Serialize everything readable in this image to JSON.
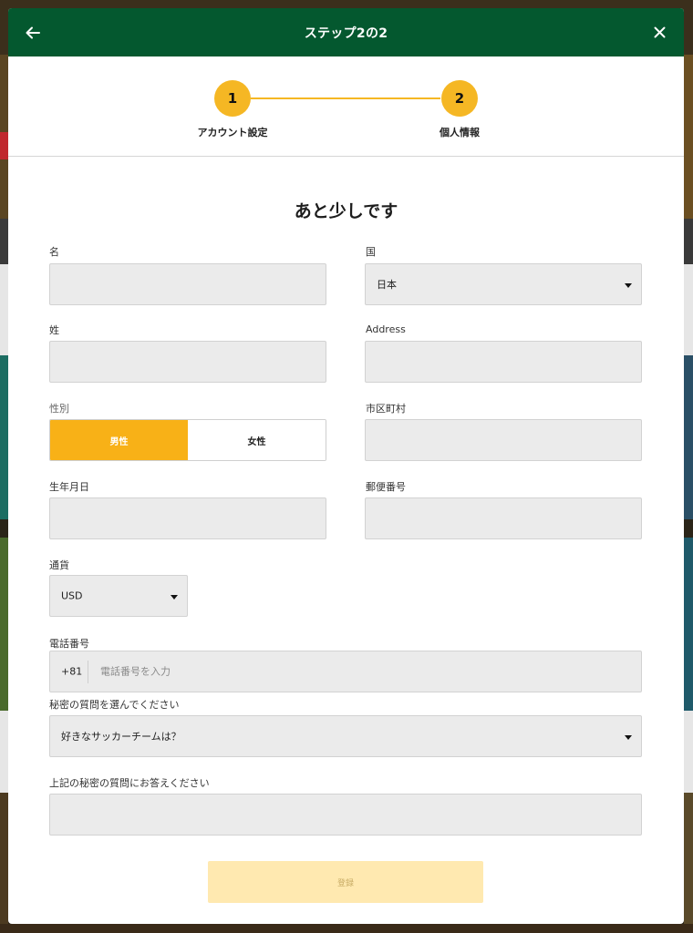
{
  "header": {
    "title": "ステップ2の2",
    "back_icon": "arrow-left-icon",
    "close_icon": "close-icon"
  },
  "stepper": {
    "steps": [
      {
        "number": "1",
        "label": "アカウント設定"
      },
      {
        "number": "2",
        "label": "個人情報"
      }
    ],
    "accent_color": "#f5b724"
  },
  "form": {
    "heading": "あと少しです",
    "first_name": {
      "label": "名",
      "value": ""
    },
    "last_name": {
      "label": "姓",
      "value": ""
    },
    "gender": {
      "label": "性別",
      "options": [
        "男性",
        "女性"
      ],
      "selected": "男性"
    },
    "birthdate": {
      "label": "生年月日",
      "value": ""
    },
    "currency": {
      "label": "通貨",
      "value": "USD"
    },
    "phone": {
      "label": "電話番号",
      "prefix": "+81",
      "placeholder": "電話番号を入力",
      "value": ""
    },
    "security_question": {
      "label": "秘密の質問を選んでください",
      "value": "好きなサッカーチームは？"
    },
    "security_answer": {
      "label": "上記の秘密の質問にお答えください",
      "value": ""
    },
    "country": {
      "label": "国",
      "value": "日本"
    },
    "address": {
      "label": "Address",
      "value": ""
    },
    "city": {
      "label": "市区町村",
      "value": ""
    },
    "postal_code": {
      "label": "郵便番号",
      "value": ""
    },
    "submit_label": "登録"
  },
  "colors": {
    "header_bg": "#04582f",
    "accent": "#f8b117",
    "submit_disabled": "#ffe9b0"
  }
}
